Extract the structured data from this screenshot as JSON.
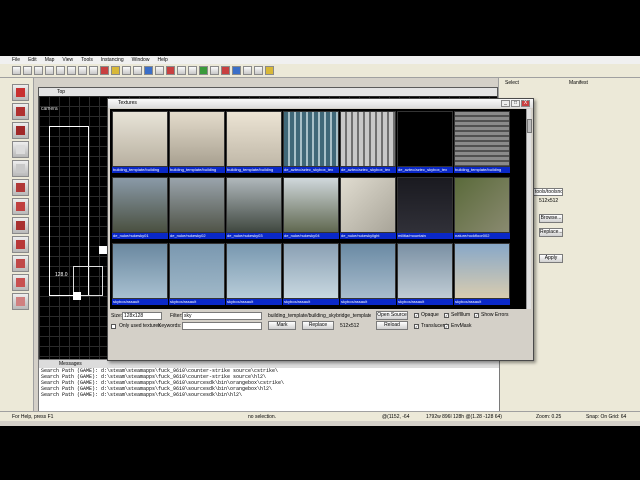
{
  "menubar": [
    "File",
    "Edit",
    "Map",
    "View",
    "Tools",
    "Instancing",
    "Window",
    "Help"
  ],
  "viewport": {
    "title": "Top",
    "camera_label": "camera",
    "size_label": "128.0"
  },
  "right_panel": {
    "select_label": "Select",
    "manifest_label": "Manifest",
    "texture_combo": "tools/toolsnodraw",
    "size_label": "512x512",
    "browse_label": "Browse...",
    "replace_label": "Replace...",
    "apply_label": "Apply"
  },
  "textures_dialog": {
    "title": "Textures",
    "min_btn": "_",
    "max_btn": "□",
    "close_btn": "X",
    "row1": [
      "building_template/building",
      "building_template/building",
      "building_template/building",
      "de_aztec/aztec_skybox_tex",
      "de_aztec/aztec_skybox_tex",
      "de_aztec/aztec_skybox_tex",
      "building_template/building"
    ],
    "row2": [
      "de_nuke/nukesky01",
      "de_nuke/nukesky02",
      "de_nuke/nukesky03",
      "de_nuke/nukesky04",
      "de_nuke/nukeskylight",
      "militia/mountain",
      "nature/rockfloor002"
    ],
    "row3": [
      "skybox/assault",
      "skybox/assault",
      "skybox/assault",
      "skybox/assault",
      "skybox/assault",
      "skybox/assault",
      "skybox/assault"
    ],
    "size_label": "Size:",
    "size_value": "128x128",
    "filter_label": "Filter:",
    "filter_value": "sky",
    "only_used_label": "Only used textures",
    "keywords_label": "Keywords:",
    "mark_label": "Mark",
    "replace_label": "Replace",
    "texture_name": "building_template/building_skybridge_template001c",
    "texture_size": "512x512",
    "open_source_label": "Open Source",
    "reload_label": "Reload",
    "opaque_label": "Opaque",
    "translucent_label": "Translucent",
    "selfillum_label": "SelfIllum",
    "envmask_label": "EnvMask",
    "show_errors_label": "Show Errors"
  },
  "messages": {
    "title": "Messages",
    "lines": [
      "Search Path (GAME): d:\\steam\\steamapps\\fuck_9610\\counter-strike source\\cstrike\\",
      "Search Path (GAME): d:\\steam\\steamapps\\fuck_9610\\counter-strike source\\hl2\\",
      "Search Path (GAME): d:\\steam\\steamapps\\fuck_9610\\sourcesdk\\bin\\orangebox\\cstrike\\",
      "Search Path (GAME): d:\\steam\\steamapps\\fuck_9610\\sourcesdk\\bin\\orangebox\\hl2\\",
      "Search Path (GAME): d:\\steam\\steamapps\\fuck_9610\\sourcesdk\\bin\\hl2\\"
    ]
  },
  "statusbar": {
    "help": "For Help, press F1",
    "selection": "no selection.",
    "coords": "@(1152, -64",
    "dims": "1792w 896l 128h @(1.28 -128 64)",
    "zoom": "Zoom: 0.25",
    "snap": "Snap: On Grid: 64"
  }
}
